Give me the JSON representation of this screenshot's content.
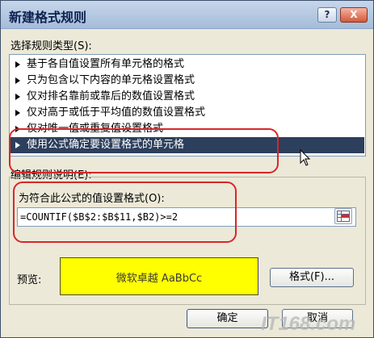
{
  "dialog": {
    "title": "新建格式规则"
  },
  "titlebar_buttons": {
    "help": "?",
    "close": "X"
  },
  "rule_types": {
    "label": "选择规则类型(S):",
    "items": [
      "基于各自值设置所有单元格的格式",
      "只为包含以下内容的单元格设置格式",
      "仅对排名靠前或靠后的数值设置格式",
      "仅对高于或低于平均值的数值设置格式",
      "仅对唯一值或重复值设置格式",
      "使用公式确定要设置格式的单元格"
    ],
    "selected_index": 5
  },
  "rule_desc": {
    "label": "编辑规则说明(E):",
    "formula_label": "为符合此公式的值设置格式(O):",
    "formula_value": "=COUNTIF($B$2:$B$11,$B2)>=2"
  },
  "preview": {
    "label": "预览:",
    "sample_text": "微软卓越  AaBbCc",
    "fill_color": "#ffff00"
  },
  "buttons": {
    "format": "格式(F)...",
    "ok": "确定",
    "cancel": "取消"
  },
  "watermark": {
    "text": "IT168.com"
  }
}
